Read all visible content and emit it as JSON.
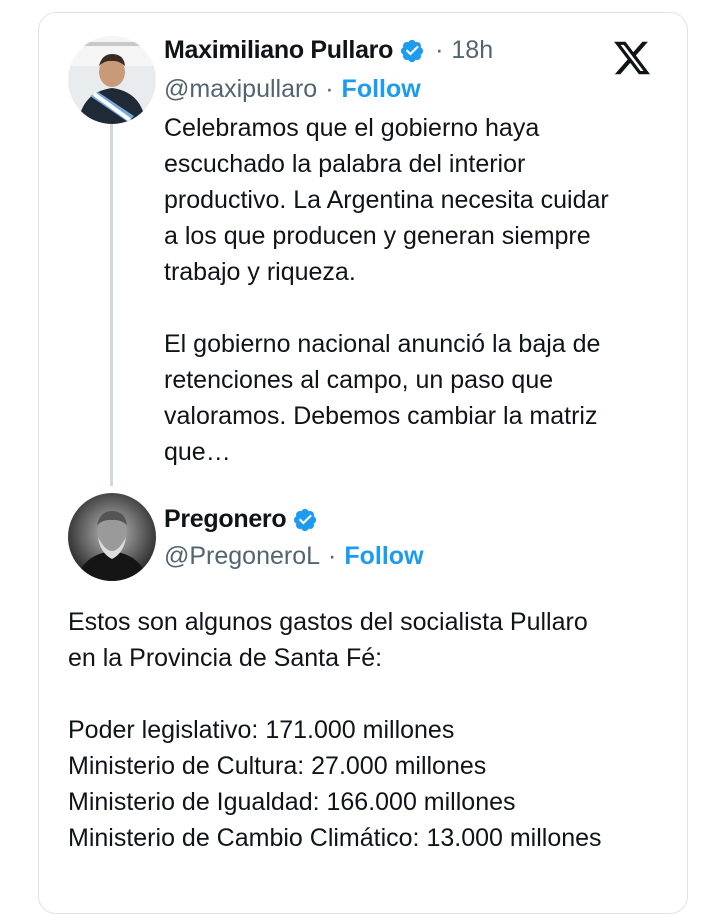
{
  "tweet1": {
    "author": "Maximiliano Pullaro",
    "time": "18h",
    "handle": "@maxipullaro",
    "follow_label": "Follow",
    "paragraphs": [
      [
        "Celebramos que el gobierno haya",
        "escuchado la palabra del interior",
        "productivo. La Argentina necesita cuidar",
        "a los que producen y generan siempre",
        "trabajo y riqueza."
      ],
      [
        "El gobierno nacional anunció la baja de",
        "retenciones al campo, un paso que",
        "valoramos. Debemos cambiar la matriz",
        "que…"
      ]
    ]
  },
  "tweet2": {
    "author": "Pregonero",
    "handle": "@PregoneroL",
    "follow_label": "Follow",
    "paragraphs": [
      [
        "Estos son algunos gastos del socialista Pullaro",
        "en la Provincia de Santa Fé:"
      ],
      [
        "Poder legislativo: 171.000 millones",
        "Ministerio de Cultura: 27.000 millones",
        "Ministerio de Igualdad: 166.000 millones",
        "Ministerio de Cambio Climático: 13.000 millones"
      ]
    ]
  },
  "icons": {
    "brand": "x-logo-icon",
    "verified": "verified-badge-icon"
  },
  "colors": {
    "link": "#1d9bf0",
    "secondary_text": "#536471",
    "thread_line": "#cfd9de"
  }
}
